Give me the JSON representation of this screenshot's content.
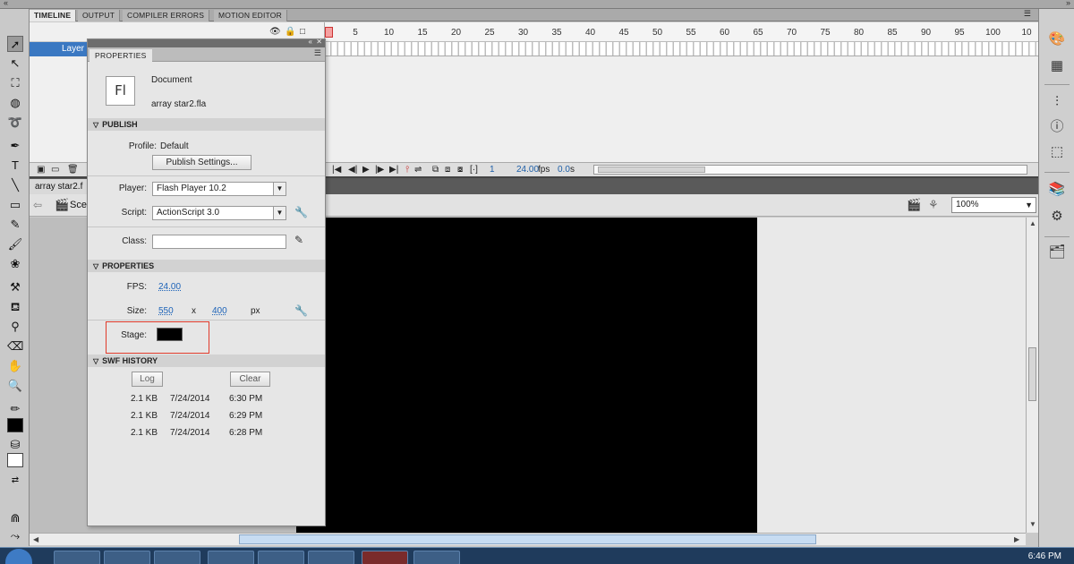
{
  "tabs": [
    "TIMELINE",
    "OUTPUT",
    "COMPILER ERRORS",
    "MOTION EDITOR"
  ],
  "timeline": {
    "layer_name": "Layer",
    "ruler_numbers": [
      "1",
      "5",
      "10",
      "15",
      "20",
      "25",
      "30",
      "35",
      "40",
      "45",
      "50",
      "55",
      "60",
      "65",
      "70",
      "75",
      "80",
      "85",
      "90",
      "95",
      "100",
      "10"
    ],
    "current_frame": "1",
    "fps": "24.00",
    "fps_unit": "fps",
    "time": "0.0",
    "time_unit": "s"
  },
  "document_tab": "array star2.f",
  "editbar": {
    "scene_label": "Sce",
    "zoom": "100%"
  },
  "properties_panel": {
    "tab": "PROPERTIES",
    "doc_type": "Document",
    "file_name": "array star2.fla",
    "icon_text": "Fl",
    "publish": {
      "header": "PUBLISH",
      "profile_label": "Profile:",
      "profile_value": "Default",
      "publish_settings_button": "Publish Settings...",
      "player_label": "Player:",
      "player_value": "Flash Player 10.2",
      "script_label": "Script:",
      "script_value": "ActionScript 3.0",
      "class_label": "Class:",
      "class_value": ""
    },
    "properties": {
      "header": "PROPERTIES",
      "fps_label": "FPS:",
      "fps_value": "24.00",
      "size_label": "Size:",
      "width": "550",
      "x_label": "x",
      "height": "400",
      "unit": "px",
      "stage_label": "Stage:",
      "stage_color": "#000000"
    },
    "swf_history": {
      "header": "SWF HISTORY",
      "log_button": "Log",
      "clear_button": "Clear",
      "entries": [
        {
          "size": "2.1 KB",
          "date": "7/24/2014",
          "time": "6:30 PM"
        },
        {
          "size": "2.1 KB",
          "date": "7/24/2014",
          "time": "6:29 PM"
        },
        {
          "size": "2.1 KB",
          "date": "7/24/2014",
          "time": "6:28 PM"
        }
      ]
    }
  },
  "taskbar": {
    "clock": "6:46 PM"
  },
  "colors": {
    "stage": "#000000",
    "pasteboard": "#e9e9e9",
    "layer_highlight": "#3a78c2",
    "highlight_box": "#e03a2a",
    "accent_link": "#1d63b8"
  },
  "icons": [
    "selection-tool-icon",
    "subselection-tool-icon",
    "free-transform-icon",
    "3d-rotation-icon",
    "lasso-icon",
    "pen-icon",
    "text-tool-icon",
    "line-tool-icon",
    "rectangle-tool-icon",
    "pencil-icon",
    "brush-icon",
    "deco-icon",
    "bone-icon",
    "paint-bucket-icon",
    "eyedropper-icon",
    "eraser-icon",
    "hand-icon",
    "zoom-icon",
    "stroke-color-icon",
    "fill-color-icon",
    "swap-colors-icon",
    "snap-icon",
    "smooth-icon",
    "color-panel-icon",
    "swatches-icon",
    "align-icon",
    "info-icon",
    "transform-icon",
    "library-icon",
    "components-icon",
    "motion-presets-icon"
  ]
}
